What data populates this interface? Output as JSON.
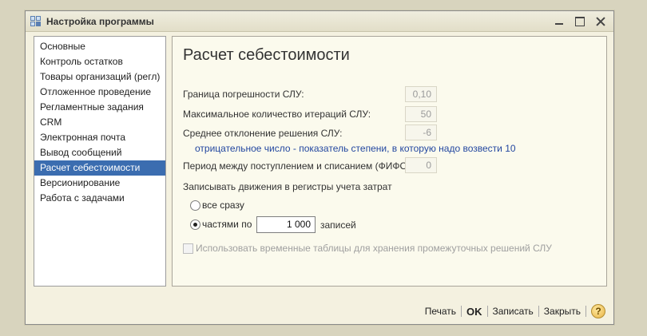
{
  "window": {
    "title": "Настройка программы"
  },
  "sidebar": {
    "items": [
      {
        "label": "Основные"
      },
      {
        "label": "Контроль остатков"
      },
      {
        "label": "Товары организаций (регл)"
      },
      {
        "label": "Отложенное проведение"
      },
      {
        "label": "Регламентные задания"
      },
      {
        "label": "CRM"
      },
      {
        "label": "Электронная почта"
      },
      {
        "label": "Вывод сообщений"
      },
      {
        "label": "Расчет себестоимости",
        "selected": true
      },
      {
        "label": "Версионирование"
      },
      {
        "label": "Работа с задачами"
      }
    ]
  },
  "main": {
    "heading": "Расчет себестоимости",
    "error_bound": {
      "label": "Граница погрешности СЛУ:",
      "value": "0,10"
    },
    "max_iterations": {
      "label": "Максимальное количество итераций СЛУ:",
      "value": "50"
    },
    "mean_deviation": {
      "label": "Среднее отклонение решения СЛУ:",
      "value": "-6"
    },
    "hint": "отрицательное число - показатель степени, в которую надо возвести 10",
    "fifo_period": {
      "label": "Период между поступлением и списанием (ФИФО):",
      "value": "0"
    },
    "write_movements_label": "Записывать движения в регистры учета затрат",
    "radio_all": {
      "label": "все сразу",
      "checked": false
    },
    "radio_parts": {
      "label": "частями по",
      "checked": true
    },
    "parts_value": "1 000",
    "parts_suffix": "записей",
    "temp_tables": {
      "label": "Использовать временные таблицы для хранения промежуточных решений СЛУ",
      "checked": false,
      "enabled": false
    }
  },
  "footer": {
    "print_label": "Печать",
    "ok_label": "OK",
    "save_label": "Записать",
    "close_label": "Закрыть",
    "help_label": "?"
  }
}
